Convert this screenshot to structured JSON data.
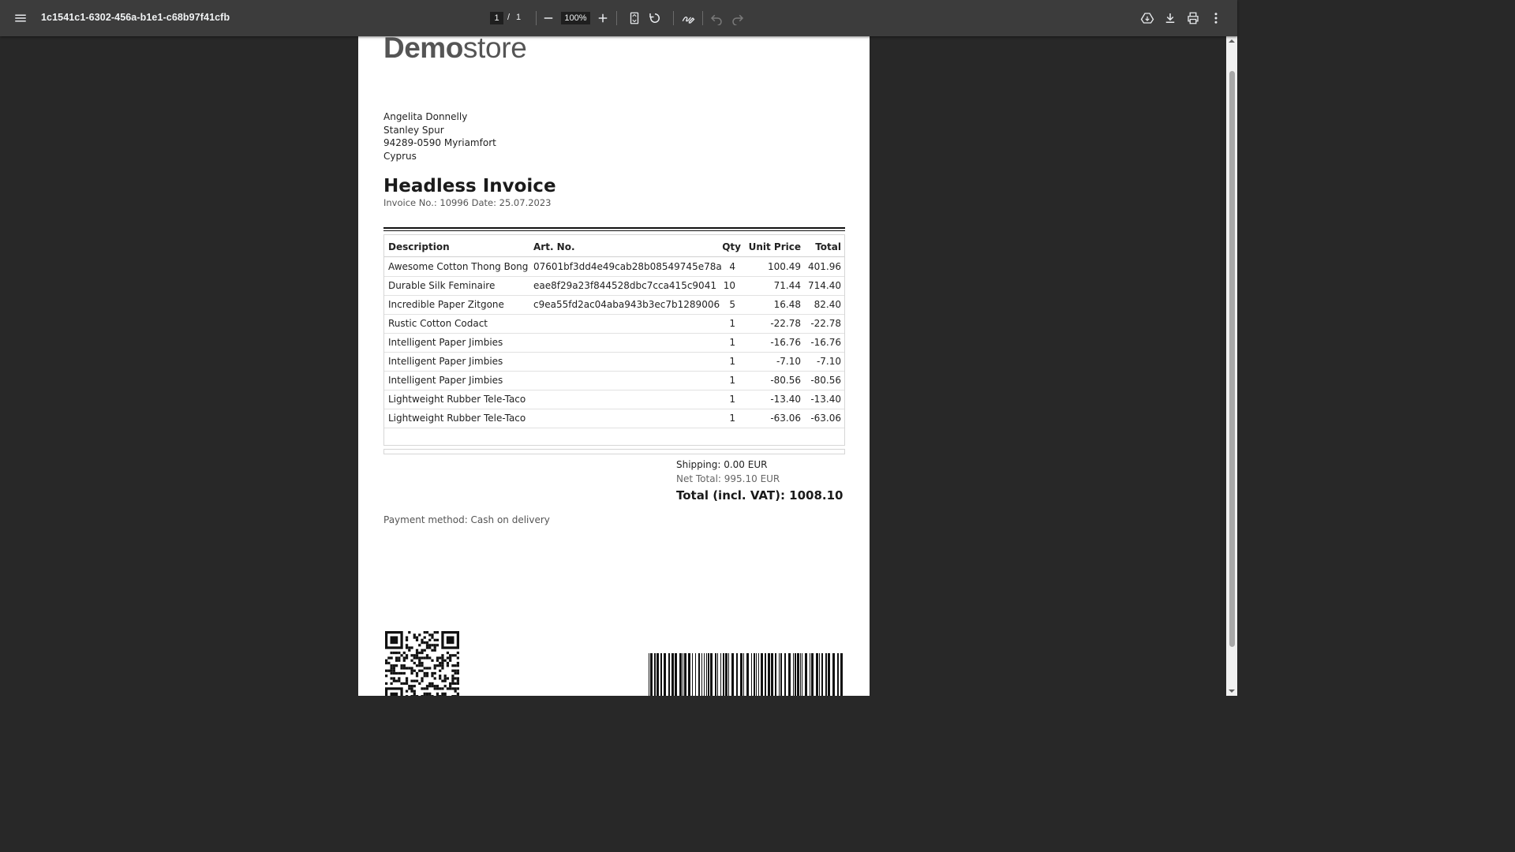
{
  "toolbar": {
    "title": "1c1541c1-6302-456a-b1e1-c68b97f41cfb",
    "page_current": "1",
    "page_separator": "/",
    "page_total": "1",
    "zoom": "100%"
  },
  "document": {
    "logo_bold": "Demo",
    "logo_light": "store",
    "address": [
      "Angelita Donnelly",
      "Stanley Spur",
      "94289-0590 Myriamfort",
      "Cyprus"
    ],
    "title": "Headless Invoice",
    "subtitle": "Invoice No.: 10996 Date: 25.07.2023",
    "table": {
      "headers": [
        "Description",
        "Art. No.",
        "Qty",
        "Unit Price",
        "Total"
      ],
      "rows": [
        [
          "Awesome Cotton Thong Bong",
          "07601bf3dd4e49cab28b08549745e78a",
          "4",
          "100.49",
          "401.96"
        ],
        [
          "Durable Silk Feminaire",
          "eae8f29a23f844528dbc7cca415c9041",
          "10",
          "71.44",
          "714.40"
        ],
        [
          "Incredible Paper Zitgone",
          "c9ea55fd2ac04aba943b3ec7b1289006",
          "5",
          "16.48",
          "82.40"
        ],
        [
          "Rustic Cotton Codact",
          "",
          "1",
          "-22.78",
          "-22.78"
        ],
        [
          "Intelligent Paper Jimbies",
          "",
          "1",
          "-16.76",
          "-16.76"
        ],
        [
          "Intelligent Paper Jimbies",
          "",
          "1",
          "-7.10",
          "-7.10"
        ],
        [
          "Intelligent Paper Jimbies",
          "",
          "1",
          "-80.56",
          "-80.56"
        ],
        [
          "Lightweight Rubber Tele-Taco",
          "",
          "1",
          "-13.40",
          "-13.40"
        ],
        [
          "Lightweight Rubber Tele-Taco",
          "",
          "1",
          "-63.06",
          "-63.06"
        ]
      ]
    },
    "shipping": "Shipping: 0.00 EUR",
    "net_total": "Net Total: 995.10 EUR",
    "total": "Total (incl. VAT): 1008.10",
    "payment": "Payment method: Cash on delivery"
  },
  "icons": {
    "menu": "menu-icon",
    "zoom_out": "minus-icon",
    "zoom_in": "plus-icon",
    "fit": "fit-page-icon",
    "rotate": "rotate-icon",
    "annotate": "draw-icon",
    "undo": "undo-icon",
    "redo": "redo-icon",
    "drive": "save-to-drive-icon",
    "download": "download-icon",
    "print": "print-icon",
    "more": "more-vert-icon"
  },
  "colors": {
    "toolbar_bg": "#3c3c3c",
    "viewer_bg": "#282828",
    "page_bg": "#ffffff"
  }
}
